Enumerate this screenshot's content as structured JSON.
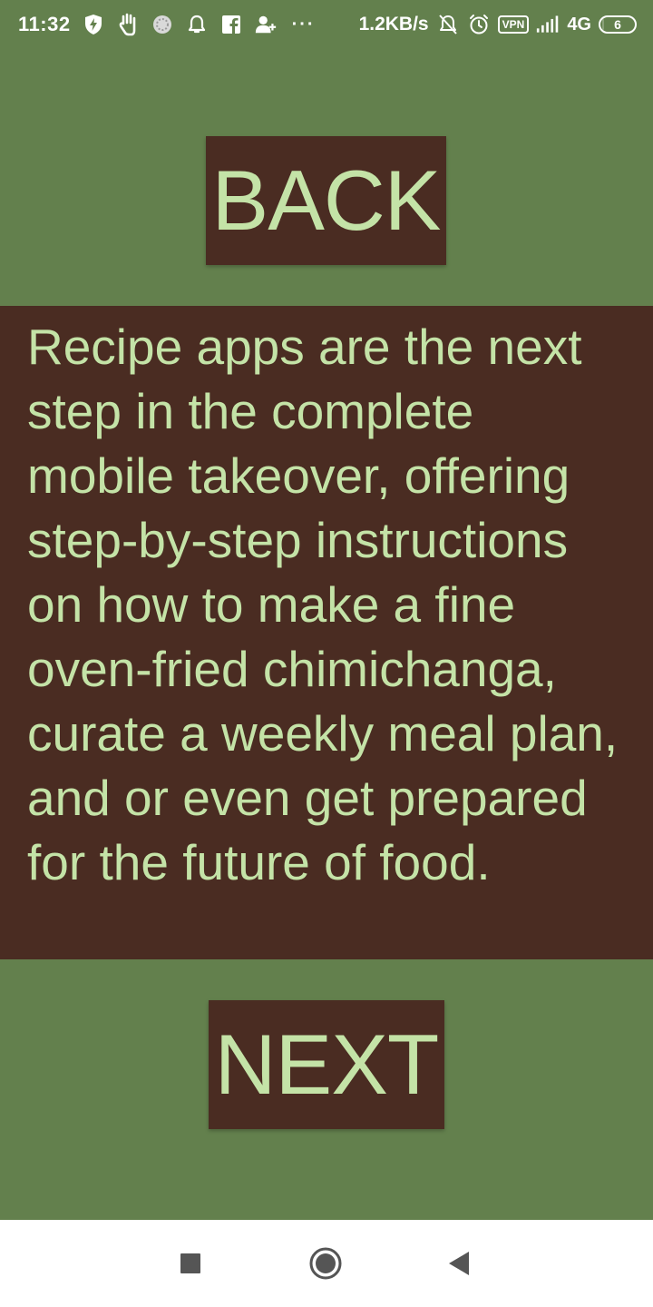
{
  "status_bar": {
    "time": "11:32",
    "net_speed": "1.2KB/s",
    "vpn_label": "VPN",
    "network_label": "4G",
    "battery_level": "6",
    "overflow_label": "···",
    "left_icons": [
      "shield-bolt-icon",
      "hand-icon",
      "sync-circle-icon",
      "bell-icon",
      "facebook-icon",
      "add-person-icon"
    ],
    "right_icons": [
      "bell-off-icon",
      "alarm-icon",
      "vpn-icon",
      "signal-icon",
      "battery-icon"
    ]
  },
  "app": {
    "back_label": "BACK",
    "next_label": "NEXT",
    "body_text": "Recipe apps are the next step in the complete mobile takeover, offering step-by-step instructions on how to make a fine oven-fried chimichanga, curate a weekly meal plan, and or even get prepared for the future of food."
  },
  "colors": {
    "background": "#63804d",
    "panel": "#4a2c22",
    "text": "#c4e3a7",
    "nav_bar": "#ffffff",
    "nav_icons": "#555555"
  },
  "nav_bar": {
    "keys": [
      "recents-key",
      "home-key",
      "back-key"
    ]
  }
}
